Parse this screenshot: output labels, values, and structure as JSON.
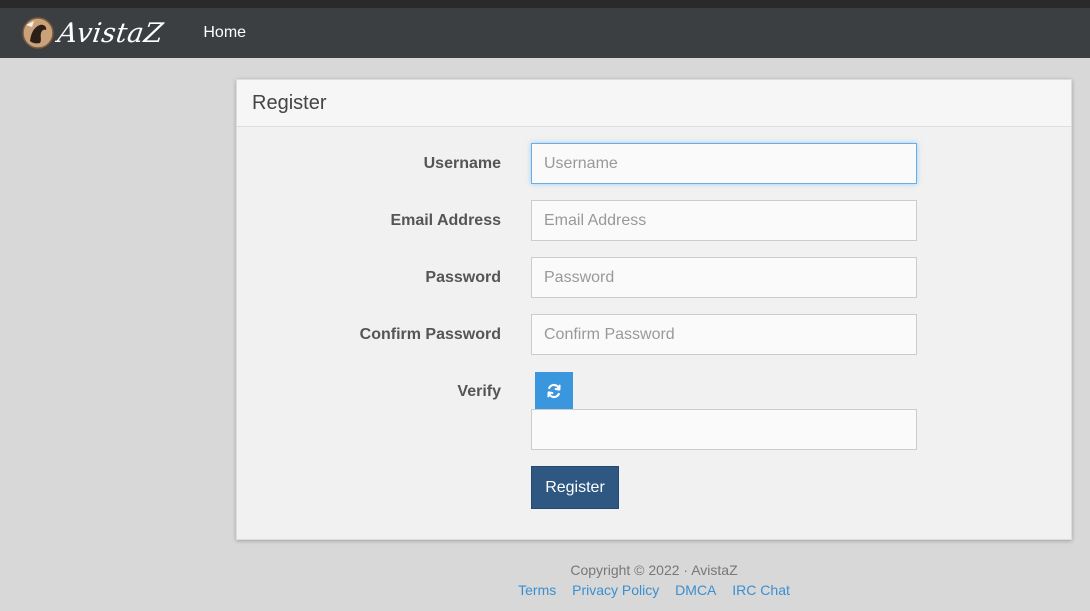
{
  "navbar": {
    "brand_text": "AvistaZ",
    "home_label": "Home"
  },
  "panel": {
    "title": "Register"
  },
  "form": {
    "username": {
      "label": "Username",
      "placeholder": "Username",
      "value": ""
    },
    "email": {
      "label": "Email Address",
      "placeholder": "Email Address",
      "value": ""
    },
    "password": {
      "label": "Password",
      "placeholder": "Password",
      "value": ""
    },
    "confirm_password": {
      "label": "Confirm Password",
      "placeholder": "Confirm Password",
      "value": ""
    },
    "verify": {
      "label": "Verify",
      "value": "",
      "refresh_icon": "refresh-icon"
    },
    "submit_label": "Register"
  },
  "footer": {
    "copyright": "Copyright © 2022 · AvistaZ",
    "links": [
      "Terms",
      "Privacy Policy",
      "DMCA",
      "IRC Chat"
    ]
  },
  "colors": {
    "navbar": "#3b3f42",
    "accent_blue": "#3a96dd",
    "button_navy": "#2e5782",
    "link": "#3a8fd0"
  }
}
